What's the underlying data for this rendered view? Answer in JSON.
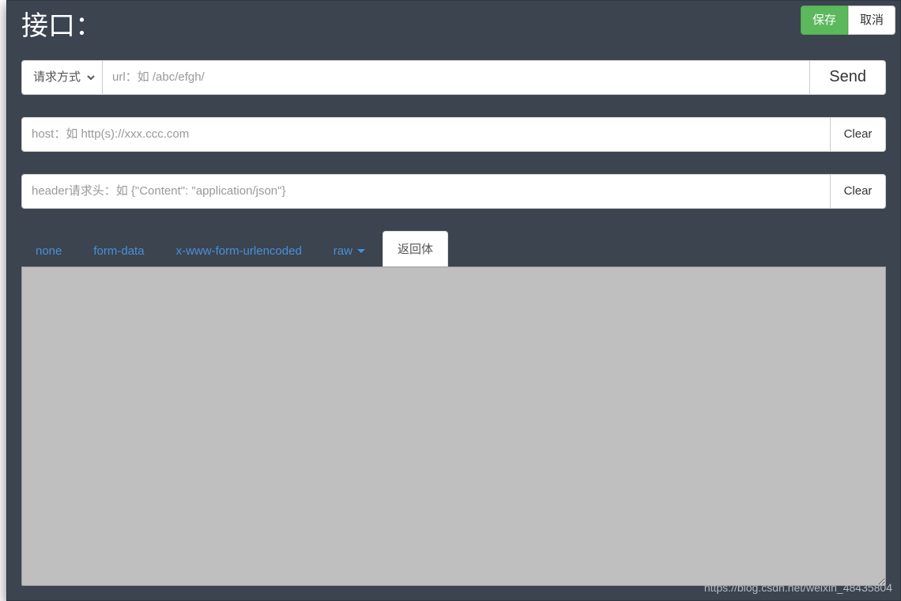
{
  "header": {
    "title": "接口：",
    "save_label": "保存",
    "cancel_label": "取消"
  },
  "request_row": {
    "method_placeholder": "请求方式",
    "url_placeholder": "url：如 /abc/efgh/",
    "send_label": "Send"
  },
  "host_row": {
    "placeholder": "host：如 http(s)://xxx.ccc.com",
    "clear_label": "Clear"
  },
  "header_row": {
    "placeholder": "header请求头：如 {\"Content\": \"application/json\"}",
    "clear_label": "Clear"
  },
  "tabs": {
    "items": [
      {
        "label": "none",
        "active": false,
        "has_caret": false
      },
      {
        "label": "form-data",
        "active": false,
        "has_caret": false
      },
      {
        "label": "x-www-form-urlencoded",
        "active": false,
        "has_caret": false
      },
      {
        "label": "raw",
        "active": false,
        "has_caret": true
      },
      {
        "label": "返回体",
        "active": true,
        "has_caret": false
      }
    ]
  },
  "response": {
    "value": ""
  },
  "watermark": "https://blog.csdn.net/weixin_48435804"
}
